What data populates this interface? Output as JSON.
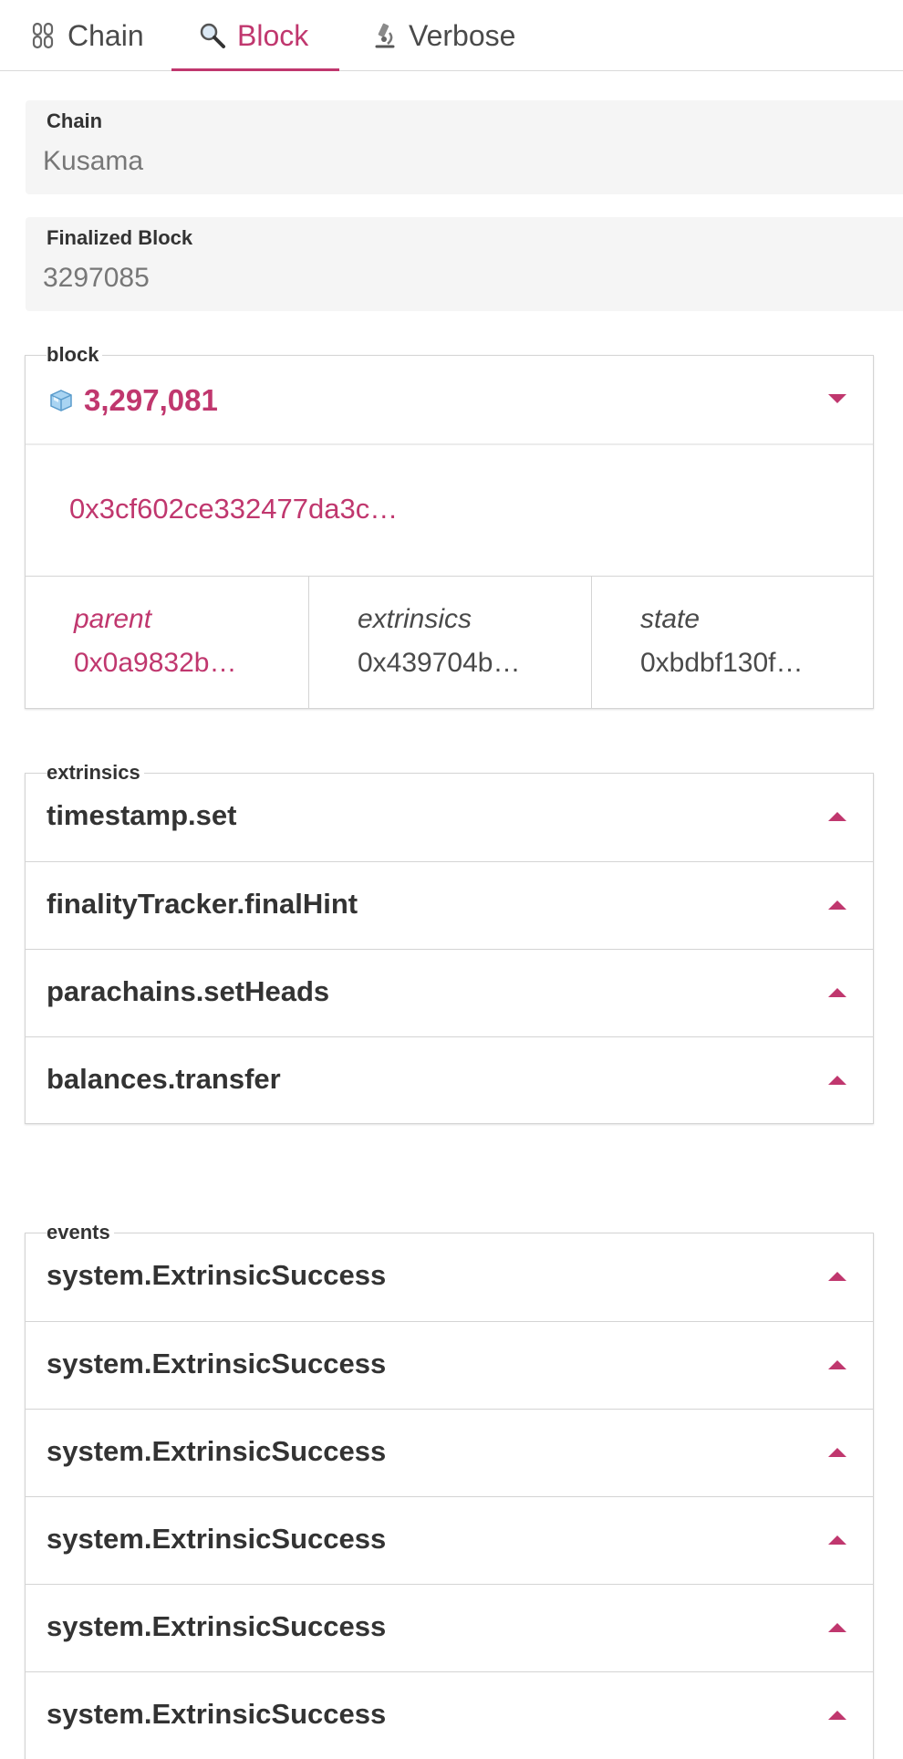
{
  "tabs": [
    {
      "label": "Chain",
      "icon": "chain-icon"
    },
    {
      "label": "Block",
      "icon": "magnifier-icon"
    },
    {
      "label": "Verbose",
      "icon": "microscope-icon"
    }
  ],
  "active_tab": "Block",
  "accent_color": "#c0376e",
  "chain_field": {
    "label": "Chain",
    "value": "Kusama"
  },
  "finalized_field": {
    "label": "Finalized Block",
    "value": "3297085"
  },
  "block": {
    "section_label": "block",
    "number": "3,297,081",
    "hash": "0x3cf602ce332477da3c…",
    "parent_label": "parent",
    "parent_value": "0x0a9832b…",
    "extrinsics_label": "extrinsics",
    "extrinsics_value": "0x439704b…",
    "state_label": "state",
    "state_value": "0xbdbf130f…"
  },
  "extrinsics": {
    "section_label": "extrinsics",
    "items": [
      "timestamp.set",
      "finalityTracker.finalHint",
      "parachains.setHeads",
      "balances.transfer"
    ]
  },
  "events": {
    "section_label": "events",
    "items": [
      "system.ExtrinsicSuccess",
      "system.ExtrinsicSuccess",
      "system.ExtrinsicSuccess",
      "system.ExtrinsicSuccess",
      "system.ExtrinsicSuccess",
      "system.ExtrinsicSuccess"
    ]
  }
}
